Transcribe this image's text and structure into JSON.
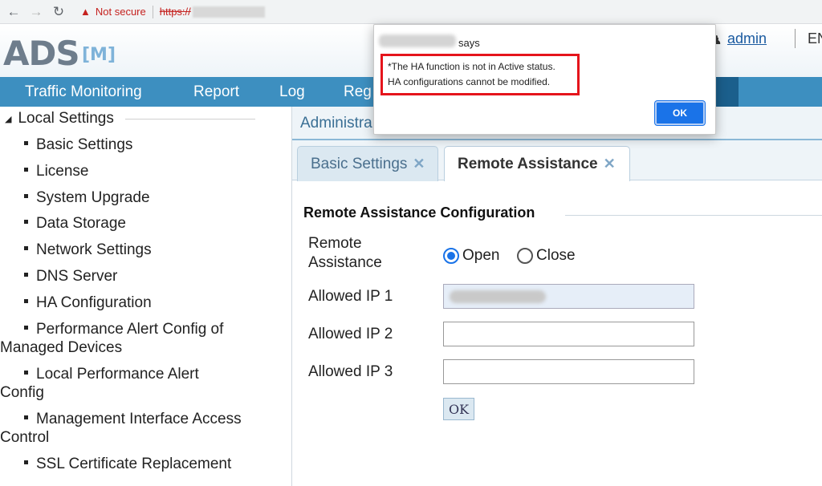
{
  "browser": {
    "not_secure": "Not secure",
    "url_scheme": "https://"
  },
  "app": {
    "logo": "ADS",
    "logo_sub": "[M]",
    "user": "admin",
    "lang": "EN"
  },
  "topnav": {
    "items": [
      "Traffic Monitoring",
      "Report",
      "Log",
      "Reg"
    ]
  },
  "sidebar": {
    "section": "Local Settings",
    "items": [
      "Basic Settings",
      "License",
      "System Upgrade",
      "Data Storage",
      "Network Settings",
      "DNS Server",
      "HA Configuration",
      "Performance Alert Config of",
      "Managed Devices",
      "Local Performance Alert",
      "Config",
      "Management Interface Access",
      "Control",
      "SSL Certificate Replacement"
    ]
  },
  "main": {
    "breadcrumb": "Administra",
    "tabs": [
      {
        "label": "Basic Settings",
        "active": false
      },
      {
        "label": "Remote Assistance",
        "active": true
      }
    ],
    "section_title": "Remote Assistance Configuration",
    "remote_assistance_label_1": "Remote",
    "remote_assistance_label_2": "Assistance",
    "radio_open": "Open",
    "radio_close": "Close",
    "radio_selected": "Open",
    "allowed_ip_1_label": "Allowed IP 1",
    "allowed_ip_2_label": "Allowed IP 2",
    "allowed_ip_3_label": "Allowed IP 3",
    "allowed_ip_2_value": "",
    "allowed_ip_3_value": "",
    "ok_label": "OK"
  },
  "dialog": {
    "says": "says",
    "message_line_1": "*The HA function is not in Active status.",
    "message_line_2": "HA configurations cannot be modified.",
    "ok_label": "OK",
    "highlight_color": "#e5141c",
    "button_color": "#1a73e8"
  },
  "colors": {
    "nav_bg": "#3d8fc0",
    "nav_dark": "#1b5f8c",
    "tab_inactive_bg": "#dbe8f1"
  }
}
